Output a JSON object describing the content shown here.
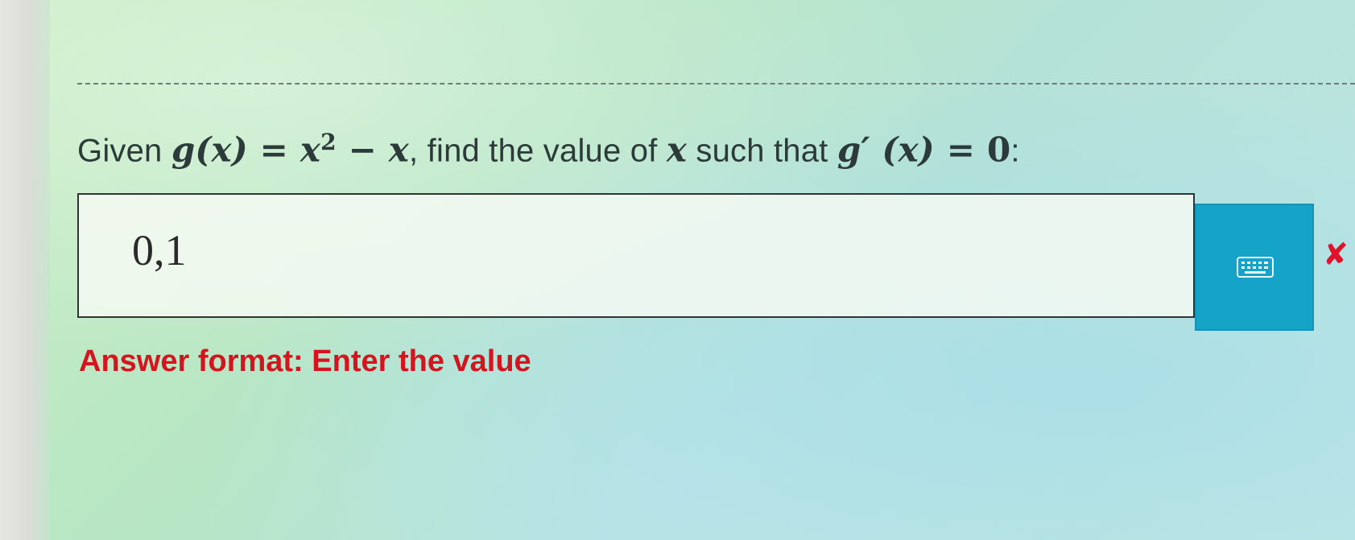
{
  "question": {
    "prefix": "Given ",
    "g_of_x": "g(x)",
    "equals1": " = ",
    "x_var": "x",
    "exponent": "2",
    "minus": " − ",
    "x_var2": "x",
    "comma_text": ", find the value of ",
    "x_var3": "x",
    "such_that": " such that ",
    "derivative": "g′ (x)",
    "equals2": " = ",
    "zero": "0",
    "colon": ":"
  },
  "answer": {
    "value": "0,1"
  },
  "keyboard": {
    "icon": "keyboard-icon",
    "color": "#16a3c8"
  },
  "status": {
    "mark": "✘",
    "color": "#e0122b"
  },
  "hint": {
    "text": "Answer format: Enter the value",
    "color": "#d4151f"
  }
}
